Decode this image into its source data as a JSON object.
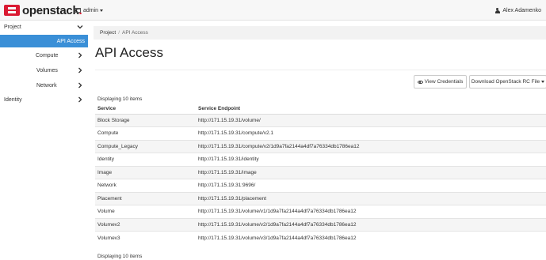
{
  "navbar": {
    "brand_text": "openstack",
    "brand_dot": ".",
    "project_switcher": "admin",
    "user_name": "Alex Adamenko"
  },
  "sidebar": {
    "items": [
      {
        "label": "Project",
        "expanded": true
      },
      {
        "label": "API Access",
        "active": true
      },
      {
        "label": "Compute"
      },
      {
        "label": "Volumes"
      },
      {
        "label": "Network"
      },
      {
        "label": "Identity"
      }
    ]
  },
  "breadcrumb": {
    "root": "Project",
    "separator": "/",
    "current": "API Access"
  },
  "page": {
    "title": "API Access"
  },
  "actions": {
    "view_credentials": "View Credentials",
    "download_rc": "Download OpenStack RC File"
  },
  "table": {
    "count_text": "Displaying 10 items",
    "columns": [
      "Service",
      "Service Endpoint"
    ],
    "rows": [
      {
        "service": "Block Storage",
        "endpoint": "http://171.15.19.31/volume/"
      },
      {
        "service": "Compute",
        "endpoint": "http://171.15.19.31/compute/v2.1"
      },
      {
        "service": "Compute_Legacy",
        "endpoint": "http://171.15.19.31/compute/v2/1d9a7fa2144a4df7a76334db1786ea12"
      },
      {
        "service": "Identity",
        "endpoint": "http://171.15.19.31/identity"
      },
      {
        "service": "Image",
        "endpoint": "http://171.15.19.31/image"
      },
      {
        "service": "Network",
        "endpoint": "http://171.15.19.31:9696/"
      },
      {
        "service": "Placement",
        "endpoint": "http://171.15.19.31/placement"
      },
      {
        "service": "Volume",
        "endpoint": "http://171.15.19.31/volume/v1/1d9a7fa2144a4df7a76334db1786ea12"
      },
      {
        "service": "Volumev2",
        "endpoint": "http://171.15.19.31/volume/v2/1d9a7fa2144a4df7a76334db1786ea12"
      },
      {
        "service": "Volumev3",
        "endpoint": "http://171.15.19.31/volume/v3/1d9a7fa2144a4df7a76334db1786ea12"
      }
    ]
  },
  "colors": {
    "brand_red": "#da1a32",
    "sidebar_active": "#3a8fd7",
    "row_stripe": "#f5f5f5"
  }
}
